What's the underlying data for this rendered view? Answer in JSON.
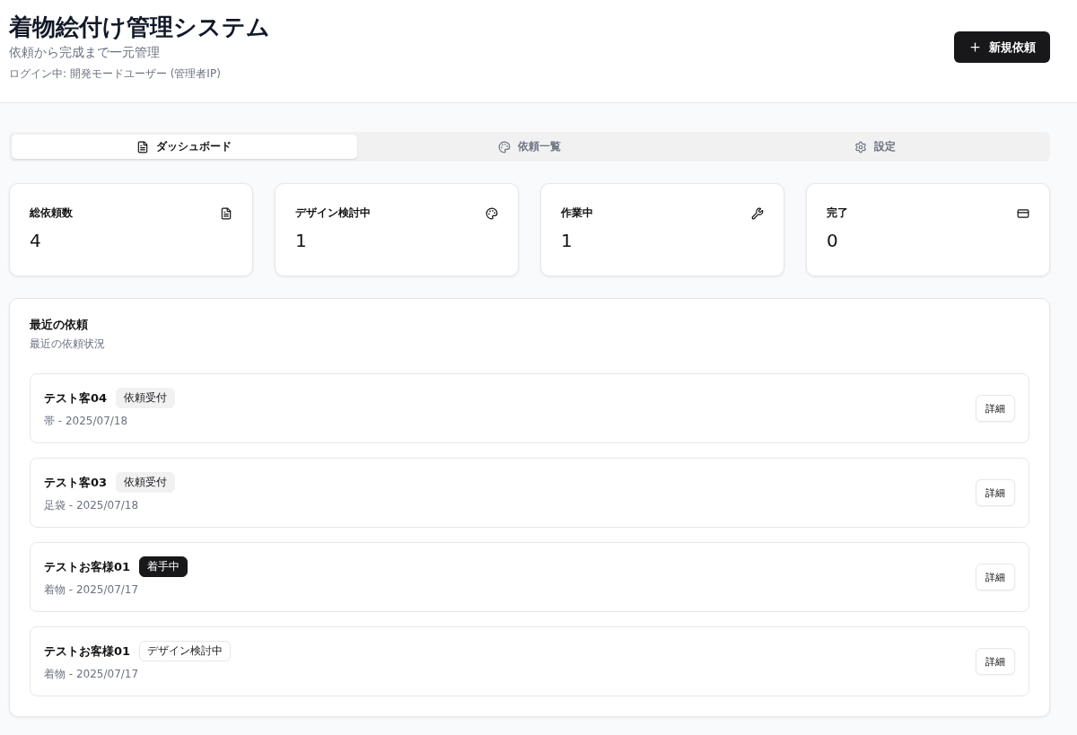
{
  "header": {
    "title": "着物絵付け管理システム",
    "subtitle": "依頼から完成まで一元管理",
    "login": "ログイン中: 開発モードユーザー (管理者IP)",
    "new_button": "新規依頼"
  },
  "tabs": [
    {
      "label": "ダッシュボード",
      "selected": true
    },
    {
      "label": "依頼一覧",
      "selected": false
    },
    {
      "label": "設定",
      "selected": false
    }
  ],
  "stats": [
    {
      "label": "総依頼数",
      "value": "4"
    },
    {
      "label": "デザイン検討中",
      "value": "1"
    },
    {
      "label": "作業中",
      "value": "1"
    },
    {
      "label": "完了",
      "value": "0"
    }
  ],
  "recent": {
    "title": "最近の依頼",
    "subtitle": "最近の依頼状況",
    "items": [
      {
        "customer": "テスト客04",
        "status": "依頼受付",
        "kind": "secondary",
        "meta": "帯 - 2025/07/18",
        "button": "詳細"
      },
      {
        "customer": "テスト客03",
        "status": "依頼受付",
        "kind": "secondary",
        "meta": "足袋 - 2025/07/18",
        "button": "詳細"
      },
      {
        "customer": "テストお客様01",
        "status": "着手中",
        "kind": "dark",
        "meta": "着物 - 2025/07/17",
        "button": "詳細"
      },
      {
        "customer": "テストお客様01",
        "status": "デザイン検討中",
        "kind": "outline",
        "meta": "着物 - 2025/07/17",
        "button": "詳細"
      }
    ]
  }
}
